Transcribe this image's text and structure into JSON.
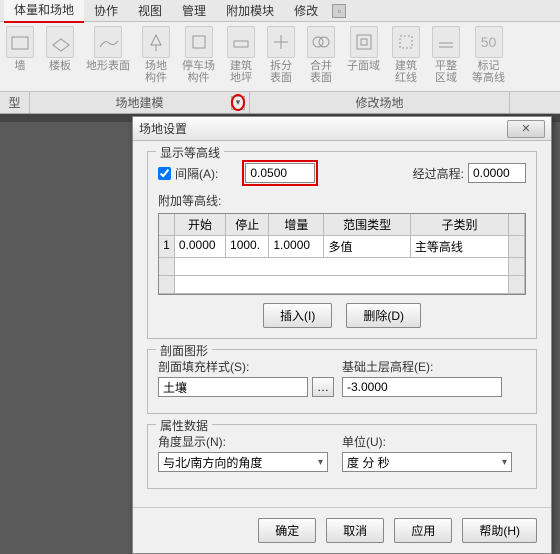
{
  "ribbon": {
    "tabs": [
      "体量和场地",
      "协作",
      "视图",
      "管理",
      "附加模块",
      "修改"
    ],
    "buttons": [
      {
        "label": "墙",
        "icon": "wall"
      },
      {
        "label": "楼板",
        "icon": "floor"
      },
      {
        "label": "地形表面",
        "icon": "topo"
      },
      {
        "label": "场地\n构件",
        "icon": "site-comp"
      },
      {
        "label": "停车场\n构件",
        "icon": "parking"
      },
      {
        "label": "建筑\n地坪",
        "icon": "bldg-pad"
      },
      {
        "label": "拆分\n表面",
        "icon": "split"
      },
      {
        "label": "合并\n表面",
        "icon": "merge"
      },
      {
        "label": "子面域",
        "icon": "subregion"
      },
      {
        "label": "建筑\n红线",
        "icon": "propline"
      },
      {
        "label": "平整\n区域",
        "icon": "graded"
      },
      {
        "label": "标记\n等高线",
        "icon": "label"
      }
    ],
    "groups": {
      "g1": "型",
      "g2": "场地建模",
      "g3": "修改场地"
    },
    "big50": "50"
  },
  "dialog": {
    "title": "场地设置",
    "close": "✕",
    "contour": {
      "group": "显示等高线",
      "interval_label": "间隔(A):",
      "interval_value": "0.0500",
      "pass_label": "经过高程:",
      "pass_value": "0.0000",
      "additional": "附加等高线:",
      "headers": {
        "start": "开始",
        "stop": "停止",
        "inc": "增量",
        "range": "范围类型",
        "sub": "子类别"
      },
      "row": {
        "n": "1",
        "start": "0.0000",
        "stop": "1000.",
        "inc": "1.0000",
        "range": "多值",
        "sub": "主等高线"
      },
      "insert": "插入(I)",
      "delete": "删除(D)"
    },
    "section": {
      "group": "剖面图形",
      "fill_label": "剖面填充样式(S):",
      "fill_value": "土壤",
      "elev_label": "基础土层高程(E):",
      "elev_value": "-3.0000"
    },
    "prop": {
      "group": "属性数据",
      "angle_label": "角度显示(N):",
      "angle_value": "与北/南方向的角度",
      "unit_label": "单位(U):",
      "unit_value": "度 分 秒"
    },
    "footer": {
      "ok": "确定",
      "cancel": "取消",
      "apply": "应用",
      "help": "帮助(H)"
    }
  }
}
